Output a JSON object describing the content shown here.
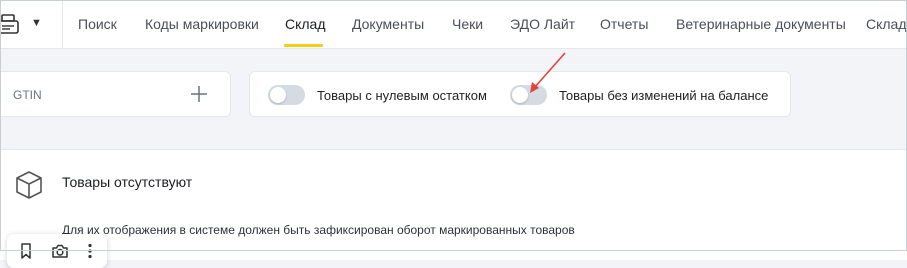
{
  "header": {
    "nav": [
      {
        "label": "Поиск"
      },
      {
        "label": "Коды маркировки"
      },
      {
        "label": "Склад",
        "active": true
      },
      {
        "label": "Документы"
      },
      {
        "label": "Чеки"
      },
      {
        "label": "ЭДО Лайт"
      },
      {
        "label": "Отчеты"
      },
      {
        "label": "Ветеринарные документы"
      },
      {
        "label": "Склад"
      }
    ],
    "accent_color": "#f1cf16"
  },
  "filters": {
    "gtin_label": "GTIN",
    "toggles": [
      {
        "label": "Товары с нулевым остатком",
        "on": false
      },
      {
        "label": "Товары без изменений на балансе",
        "on": false
      }
    ]
  },
  "empty_state": {
    "title": "Товары отсутствуют",
    "description": "Для их отображения в системе должен быть зафиксирован оборот маркированных товаров"
  },
  "icons": {
    "logo": "cash-register-icon",
    "caret": "caret-down-icon",
    "plus": "plus-icon",
    "box": "box-icon",
    "bookmark": "bookmark-icon",
    "camera": "camera-icon",
    "more": "more-vertical-icon"
  },
  "annotation_color": "#e0443a"
}
